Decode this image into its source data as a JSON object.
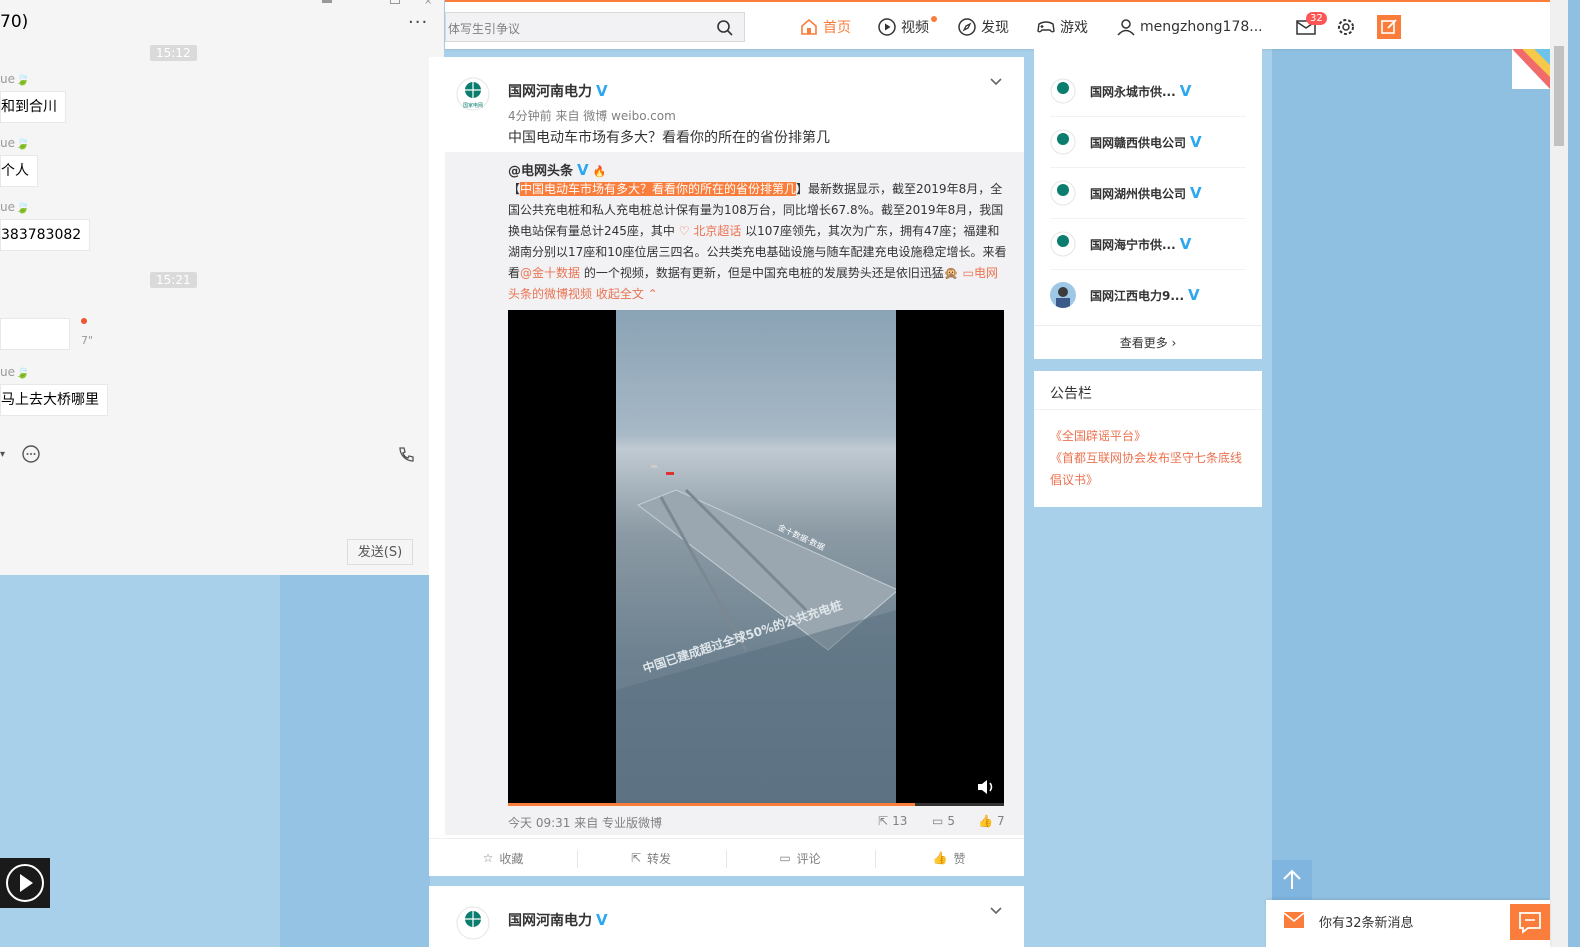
{
  "topbar": {
    "search_placeholder": "体写生引争议",
    "nav": [
      {
        "label": "首页",
        "icon": "home-icon"
      },
      {
        "label": "视频",
        "icon": "video-icon"
      },
      {
        "label": "发现",
        "icon": "compass-icon"
      },
      {
        "label": "游戏",
        "icon": "gamepad-icon"
      },
      {
        "label": "mengzhong178...",
        "icon": "user-icon"
      }
    ],
    "mail_badge": "32"
  },
  "chat": {
    "title": "70)",
    "messages": [
      {
        "time": "15:12"
      },
      {
        "sender": "ue🍃",
        "text": "和到合川"
      },
      {
        "sender": "ue🍃",
        "text": "个人"
      },
      {
        "sender": "ue🍃",
        "text": "383783082"
      },
      {
        "time": "15:21"
      },
      {
        "voice_len": "7\""
      },
      {
        "sender": "ue🍃",
        "text": "马上去大桥哪里"
      }
    ],
    "send_label": "发送(S)"
  },
  "post1": {
    "author": "国网河南电力",
    "meta": "4分钟前 来自 微博 weibo.com",
    "text": "中国电动车市场有多大？看看你的所在的省份排第几",
    "repost": {
      "author": "@电网头条",
      "body_pre": "【",
      "headline": "中国电动车市场有多大？看看你的所在的省份排第几",
      "body_a": "】最新数据显示，截至2019年8月，全国公共充电桩和私人充电桩总计保有量为108万台，同比增长67.8%。截至2019年8月，我国换电站保有量总计245座，其中",
      "link_place": "北京超话",
      "body_b": "以107座领先，其次为广东，拥有47座；福建和湖南分别以17座和10座位居三四名。公共类充电基础设施与随车配建充电设施稳定增长。来看看",
      "link_user": "@金十数据",
      "body_c": "的一个视频，数据有更新，但是中国充电桩的发展势头还是依旧迅猛",
      "link_video": "电网头条的微博视频",
      "collapse": "收起全文",
      "video_caption": "中国已建成超过全球50%的公共充电桩",
      "video_label": "金十数据·数据",
      "progress": 0.82,
      "footer": "今天 09:31 来自 专业版微博",
      "shares": "13",
      "comments": "5",
      "likes": "7"
    },
    "actions": [
      "收藏",
      "转发",
      "评论",
      "赞"
    ]
  },
  "post2": {
    "author": "国网河南电力"
  },
  "sidebar": {
    "recommend": [
      {
        "name": "国网永城市供..."
      },
      {
        "name": "国网赣西供电公司"
      },
      {
        "name": "国网湖州供电公司"
      },
      {
        "name": "国网海宁市供..."
      },
      {
        "name": "国网江西电力9..."
      }
    ],
    "more_label": "查看更多 ›",
    "notice_title": "公告栏",
    "notices": [
      "《全国辟谣平台》",
      "《首都互联网协会发布坚守七条底线倡议书》"
    ]
  },
  "notification": {
    "text": "你有32条新消息"
  }
}
